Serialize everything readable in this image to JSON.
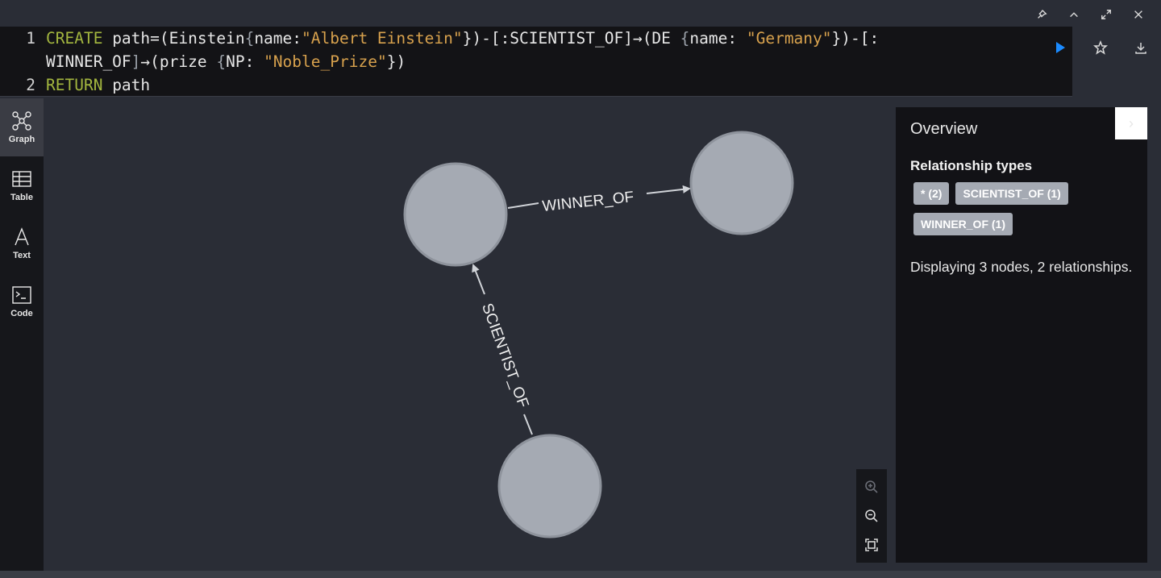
{
  "window": {
    "controls": [
      {
        "name": "pin-icon"
      },
      {
        "name": "chevron-up-icon"
      },
      {
        "name": "expand-icon"
      },
      {
        "name": "close-icon"
      }
    ]
  },
  "editor": {
    "line_numbers": [
      "1",
      "2"
    ],
    "line1a": [
      {
        "t": "CREATE",
        "c": "kw"
      },
      {
        "t": " path=(Einstein",
        "c": ""
      },
      {
        "t": "{",
        "c": "brc"
      },
      {
        "t": "name:",
        "c": ""
      },
      {
        "t": "\"Albert Einstein\"",
        "c": "str"
      },
      {
        "t": "})-[:SCIENTIST_OF]",
        "c": ""
      },
      {
        "t": "→",
        "c": ""
      },
      {
        "t": "(DE ",
        "c": ""
      },
      {
        "t": "{",
        "c": "brc"
      },
      {
        "t": "name: ",
        "c": ""
      },
      {
        "t": "\"Germany\"",
        "c": "str"
      },
      {
        "t": "})-[:",
        "c": ""
      }
    ],
    "line1b": [
      {
        "t": "WINNER_OF",
        "c": ""
      },
      {
        "t": "]",
        "c": "brc"
      },
      {
        "t": "→",
        "c": ""
      },
      {
        "t": "(prize ",
        "c": ""
      },
      {
        "t": "{",
        "c": "brc"
      },
      {
        "t": "NP: ",
        "c": ""
      },
      {
        "t": "\"Noble_Prize\"",
        "c": "str"
      },
      {
        "t": "})",
        "c": ""
      }
    ],
    "line2": [
      {
        "t": "RETURN",
        "c": "kw"
      },
      {
        "t": " path",
        "c": ""
      }
    ],
    "run_color": "#1b8bff"
  },
  "sidebar": {
    "items": [
      {
        "label": "Graph",
        "icon": "graph-icon",
        "active": true
      },
      {
        "label": "Table",
        "icon": "table-icon",
        "active": false
      },
      {
        "label": "Text",
        "icon": "text-icon",
        "active": false
      },
      {
        "label": "Code",
        "icon": "code-icon",
        "active": false
      }
    ]
  },
  "graph": {
    "node_color": "#a5aab3",
    "edges": [
      {
        "label": "WINNER_OF"
      },
      {
        "label": "SCIENTIST_OF"
      }
    ]
  },
  "overview": {
    "title": "Overview",
    "subtitle": "Relationship types",
    "tags": [
      "* (2)",
      "SCIENTIST_OF (1)",
      "WINNER_OF (1)"
    ],
    "description": "Displaying 3 nodes, 2 relationships."
  }
}
